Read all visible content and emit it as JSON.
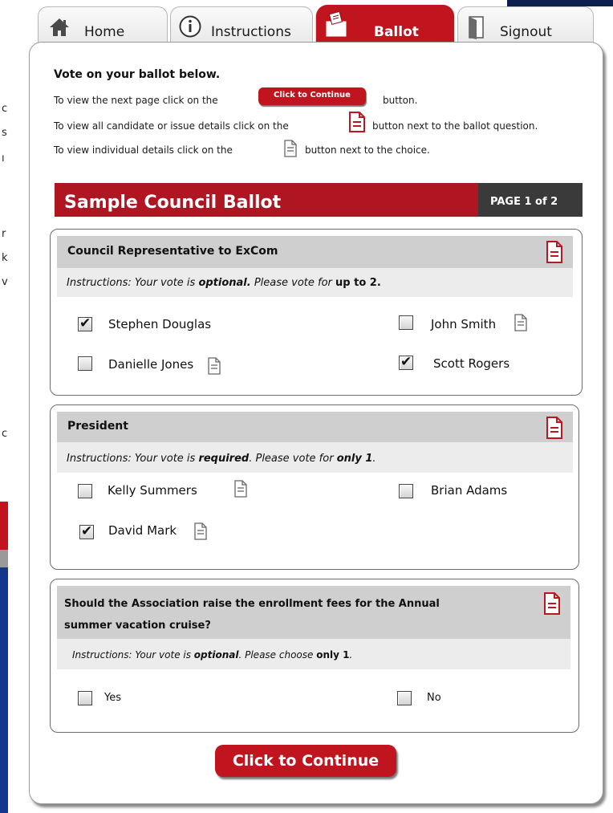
{
  "left_fragments": [
    "c",
    "s",
    "ı",
    "r",
    "k",
    "v",
    "c"
  ],
  "tabs": {
    "home": "Home",
    "instructions": "Instructions",
    "ballot": "Ballot",
    "signout": "Signout"
  },
  "intro": {
    "title": "Vote on your ballot below.",
    "line1_before": "To view the next page click on the",
    "line1_button": "Click to Continue",
    "line1_after": "button.",
    "line2_before": "To view all candidate or issue details click on the",
    "line2_after": "button next to the ballot question.",
    "line3_before": "To view individual details click on the",
    "line3_after": "button next to the choice."
  },
  "ballot": {
    "title": "Sample Council Ballot",
    "page_label": "PAGE 1 of 2"
  },
  "contests": [
    {
      "title": "Council Representative to ExCom",
      "instr_prefix": "Instructions: Your vote is ",
      "instr_emph": "optional.",
      "instr_mid": " Please vote for ",
      "instr_limit": "up to 2.",
      "choices": [
        {
          "name": "Stephen Douglas",
          "checked": true
        },
        {
          "name": "John Smith",
          "checked": false
        },
        {
          "name": "Danielle Jones",
          "checked": false
        },
        {
          "name": "Scott Rogers",
          "checked": true
        }
      ]
    },
    {
      "title": "President",
      "instr_prefix": "Instructions: Your vote is ",
      "instr_emph": "required",
      "instr_mid": ".  Please vote for ",
      "instr_limit": "only 1",
      "instr_end": ".",
      "choices": [
        {
          "name": "Kelly Summers",
          "checked": false
        },
        {
          "name": "Brian Adams",
          "checked": false
        },
        {
          "name": "David Mark",
          "checked": true
        }
      ]
    },
    {
      "title_line1": "Should the Association raise the enrollment fees for the Annual",
      "title_line2": "summer vacation cruise?",
      "instr_prefix": "Instructions: Your vote is ",
      "instr_emph": "optional",
      "instr_mid": ".  Please choose ",
      "instr_limit": "only 1",
      "instr_end": ".",
      "choices": [
        {
          "name": "Yes",
          "checked": false
        },
        {
          "name": "No",
          "checked": false
        }
      ]
    }
  ],
  "checkmark": "✔",
  "continue_label": "Click to Continue",
  "colors": {
    "accent": "#c0151f",
    "dark": "#3a3a3a",
    "section_bar": "#cfcfcf"
  }
}
